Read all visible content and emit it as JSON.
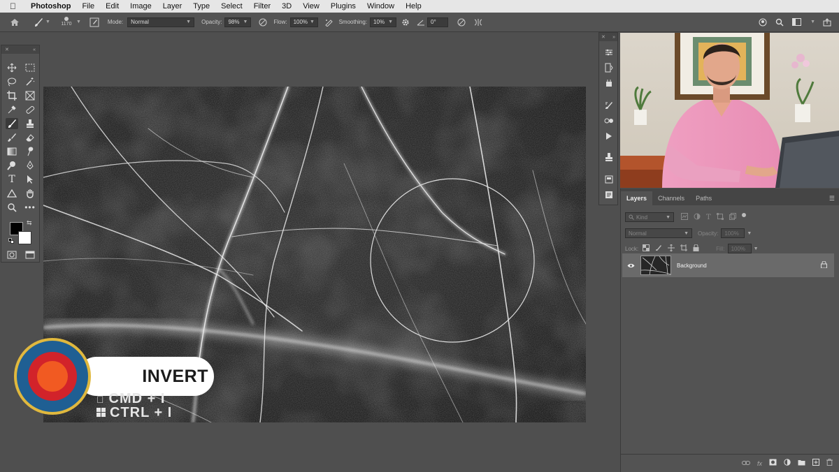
{
  "menubar": {
    "app_name": "Photoshop",
    "items": [
      "File",
      "Edit",
      "Image",
      "Layer",
      "Type",
      "Select",
      "Filter",
      "3D",
      "View",
      "Plugins",
      "Window",
      "Help"
    ]
  },
  "options_bar": {
    "brush_size": "1170",
    "mode_label": "Mode:",
    "mode_value": "Normal",
    "opacity_label": "Opacity:",
    "opacity_value": "98%",
    "flow_label": "Flow:",
    "flow_value": "100%",
    "smoothing_label": "Smoothing:",
    "smoothing_value": "10%",
    "angle_value": "0°"
  },
  "layers_panel": {
    "tabs": [
      "Layers",
      "Channels",
      "Paths"
    ],
    "active_tab": "Layers",
    "kind_placeholder": "Kind",
    "blend_mode": "Normal",
    "opacity_label": "Opacity:",
    "opacity_value": "100%",
    "lock_label": "Lock:",
    "fill_label": "Fill:",
    "fill_value": "100%",
    "layers": [
      {
        "name": "Background",
        "visible": true,
        "locked": true
      }
    ]
  },
  "callout": {
    "title": "INVERT",
    "mac_shortcut": "CMD + I",
    "win_shortcut": "CTRL + I"
  },
  "colors": {
    "foreground": "#000000",
    "background": "#ffffff",
    "badge_ring": "#e0b83e",
    "badge_blue": "#1f5f93",
    "badge_red": "#d2232a",
    "badge_orange": "#f15a22"
  }
}
